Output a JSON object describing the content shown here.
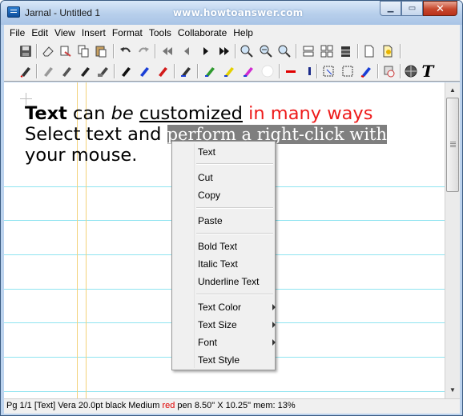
{
  "window": {
    "title": "Jarnal - Untitled 1",
    "watermark": "www.howtoanswer.com"
  },
  "menubar": {
    "items": [
      "File",
      "Edit",
      "View",
      "Insert",
      "Format",
      "Tools",
      "Collaborate",
      "Help"
    ]
  },
  "toolbar": {
    "row1_icons": [
      "save-icon",
      "eraser-icon",
      "cut-icon",
      "copy-icon",
      "paste-icon",
      "undo-icon",
      "redo-icon",
      "first-page-icon",
      "previous-page-icon",
      "next-page-icon",
      "last-page-icon",
      "zoom-in-icon",
      "zoom-out-icon",
      "zoom-fit-icon",
      "split-view-icon",
      "page-layout-icon",
      "stack-icon",
      "new-page-icon",
      "open-page-icon"
    ],
    "row2_icons": [
      "pen-red-icon",
      "pen-gray-icon",
      "pen-dark-icon",
      "pen-dark2-icon",
      "eraser-pen-icon",
      "pen-black-icon",
      "pen-blue-icon",
      "pen-red2-icon",
      "pen-special-icon",
      "highlighter-green-icon",
      "highlighter-yellow-icon",
      "highlighter-magenta-icon",
      "white-circle-icon",
      "red-line-icon",
      "blue-line-icon",
      "select-rect-icon",
      "select-lasso-icon",
      "marker-icon",
      "stamp-icon",
      "globe-icon",
      "text-tool-icon"
    ],
    "text_tool_glyph": "T"
  },
  "document": {
    "line1": {
      "w1": "Text",
      "w2": " can ",
      "w3": "be",
      "w4": " ",
      "w5": "customized",
      "w6": " ",
      "w7": "in many ways"
    },
    "line2": {
      "plain": "Select text and ",
      "selected": "perform a right-click with"
    },
    "line3": {
      "plain": "your mouse."
    },
    "colors": {
      "red_text": "#ee1b1b",
      "selection_bg": "#7f7f7f",
      "rule_line": "#8fe3f0",
      "margin_line": "#f3d27a"
    }
  },
  "context_menu": {
    "groups": [
      [
        "Text"
      ],
      [
        "Cut",
        "Copy"
      ],
      [
        "Paste"
      ],
      [
        "Bold Text",
        "Italic Text",
        "Underline Text"
      ],
      [
        "Text Color",
        "Text Size",
        "Font",
        "Text Style"
      ]
    ],
    "submenu_items": [
      "Text Color",
      "Text Size",
      "Font"
    ]
  },
  "statusbar": {
    "left": "Pg 1/1 [Text] Vera 20.0pt black  Medium ",
    "pen_color": "red",
    "right": " pen  8.50\" X 10.25\"   mem: 13%"
  }
}
